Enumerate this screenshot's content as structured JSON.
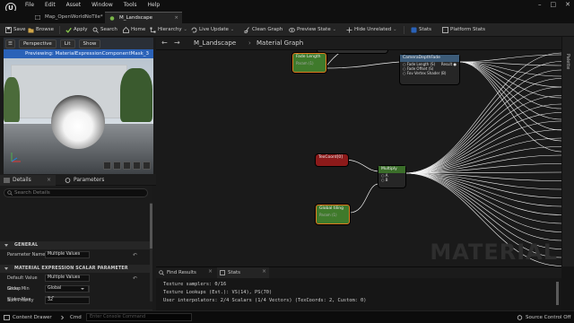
{
  "menu": [
    "File",
    "Edit",
    "Asset",
    "Window",
    "Tools",
    "Help"
  ],
  "tabs": [
    {
      "label": "Map_OpenWorldNoTile*",
      "active": false
    },
    {
      "label": "M_Landscape",
      "active": true
    }
  ],
  "toolbar": {
    "save": "Save",
    "browse": "Browse",
    "apply": "Apply",
    "search": "Search",
    "home": "Home",
    "hierarchy": "Hierarchy",
    "live_update": "Live Update",
    "clean_graph": "Clean Graph",
    "preview_state": "Preview State",
    "hide_unrelated": "Hide Unrelated",
    "stats": "Stats",
    "platform_stats": "Platform Stats"
  },
  "viewport": {
    "perspective": "Perspective",
    "lit": "Lit",
    "show": "Show",
    "banner": "Previewing: MaterialExpressionComponentMask_3"
  },
  "panel_tabs": {
    "details": "Details",
    "parameters": "Parameters"
  },
  "details": {
    "search_placeholder": "Search Details",
    "general": {
      "header": "GENERAL",
      "param_name_label": "Parameter Name",
      "param_name_value": "Multiple Values"
    },
    "scalar": {
      "header": "MATERIAL EXPRESSION SCALAR PARAMETER",
      "default_label": "Default Value",
      "default_value": "Multiple Values",
      "min_label": "Slider Min",
      "min_value": "0.0",
      "max_label": "Slider Max",
      "max_value": "0.0"
    },
    "expression": {
      "header": "MATERIAL EXPRESSION",
      "group_label": "Group",
      "group_value": "Global",
      "priority_label": "Sort Priority",
      "priority_value": "32"
    }
  },
  "graph": {
    "title": "M_Landscape",
    "breadcrumb": "Material Graph",
    "watermark": "MATERIAL",
    "nodes": {
      "fade_length": {
        "title": "Fade Length",
        "sub": "Param (1)"
      },
      "camera_depth_fade": {
        "title": "CameraDepthFade",
        "pins": [
          "Fade Length (S)",
          "Fade Offset (S)",
          "Fov Vertex Shader (B)"
        ],
        "output": "Result"
      },
      "texcoord": {
        "title": "TexCoord[0]"
      },
      "multiply": {
        "title": "Multiply",
        "pins": [
          "A",
          "B"
        ]
      },
      "global_tiling": {
        "title": "Global tiling",
        "sub": "Param (1)"
      }
    }
  },
  "palette_label": "Palette",
  "bottom": {
    "tabs": {
      "find_results": "Find Results",
      "stats": "Stats"
    },
    "stats_lines": [
      "Texture samplers: 0/16",
      "Texture Lookups (Est.): VS(14), PS(70)",
      "User interpolators: 2/4 Scalars (1/4 Vectors) (TexCoords: 2, Custom: 0)"
    ]
  },
  "status": {
    "content_drawer": "Content Drawer",
    "cmd": "Cmd",
    "cmd_placeholder": "Enter Console Command",
    "source_control": "Source Control Off"
  },
  "colors": {
    "accent_blue": "#2a62b8",
    "node_orange": "#e07a20",
    "param_green": "#3f7a2b",
    "texcoord_red": "#8c1a1a"
  }
}
